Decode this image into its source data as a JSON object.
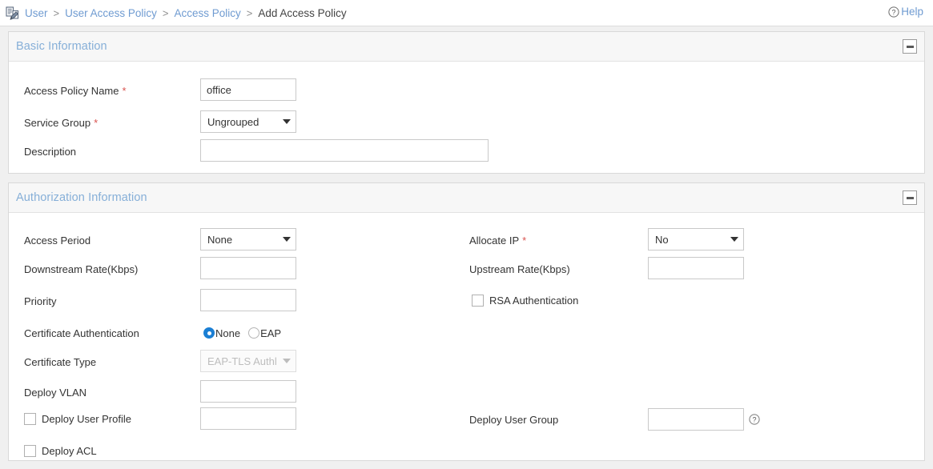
{
  "breadcrumb": {
    "icon": "edit-document-icon",
    "separator": ">",
    "items": [
      {
        "label": "User",
        "link": true
      },
      {
        "label": "User Access Policy",
        "link": true
      },
      {
        "label": "Access Policy",
        "link": true
      },
      {
        "label": "Add Access Policy",
        "link": false
      }
    ]
  },
  "help": {
    "icon": "question-circle-icon",
    "label": "Help"
  },
  "colors": {
    "link": "#6f9bd1",
    "panel_title": "#86afd8",
    "required_asterisk": "#d9534f",
    "radio_selected": "#1b7fd4",
    "panel_header_bg": "#f7f7f7",
    "page_bg": "#f0f0f0",
    "border": "#d9d9d9"
  },
  "panels": {
    "basic": {
      "title": "Basic Information",
      "collapse_icon": "minus-icon",
      "fields": {
        "policy_name": {
          "label": "Access Policy Name",
          "required": "*",
          "value": "office",
          "placeholder": ""
        },
        "service_group": {
          "label": "Service Group",
          "required": "*",
          "value": "Ungrouped"
        },
        "description": {
          "label": "Description",
          "value": "",
          "placeholder": ""
        }
      }
    },
    "authorization": {
      "title": "Authorization Information",
      "collapse_icon": "minus-icon",
      "fields": {
        "access_period": {
          "label": "Access Period",
          "value": "None"
        },
        "allocate_ip": {
          "label": "Allocate IP",
          "required": "*",
          "value": "No"
        },
        "downstream_rate": {
          "label": "Downstream Rate(Kbps)",
          "value": "",
          "placeholder": ""
        },
        "upstream_rate": {
          "label": "Upstream Rate(Kbps)",
          "value": "",
          "placeholder": ""
        },
        "priority": {
          "label": "Priority",
          "value": "",
          "placeholder": ""
        },
        "rsa_authentication": {
          "label": "RSA Authentication",
          "checked": false
        },
        "certificate_authentication": {
          "label": "Certificate Authentication",
          "selected": "None",
          "options": [
            {
              "label": "None",
              "selected": true
            },
            {
              "label": "EAP",
              "selected": false
            }
          ]
        },
        "certificate_type": {
          "label": "Certificate Type",
          "value": "EAP-TLS Authl",
          "disabled": true
        },
        "deploy_vlan": {
          "label": "Deploy VLAN",
          "value": "",
          "placeholder": ""
        },
        "deploy_user_profile": {
          "label": "Deploy User Profile",
          "checked": false,
          "value": "",
          "placeholder": ""
        },
        "deploy_user_group": {
          "label": "Deploy User Group",
          "value": "",
          "placeholder": "",
          "tip_icon": "question-circle-icon"
        },
        "deploy_acl": {
          "label": "Deploy ACL",
          "checked": false
        }
      }
    }
  }
}
